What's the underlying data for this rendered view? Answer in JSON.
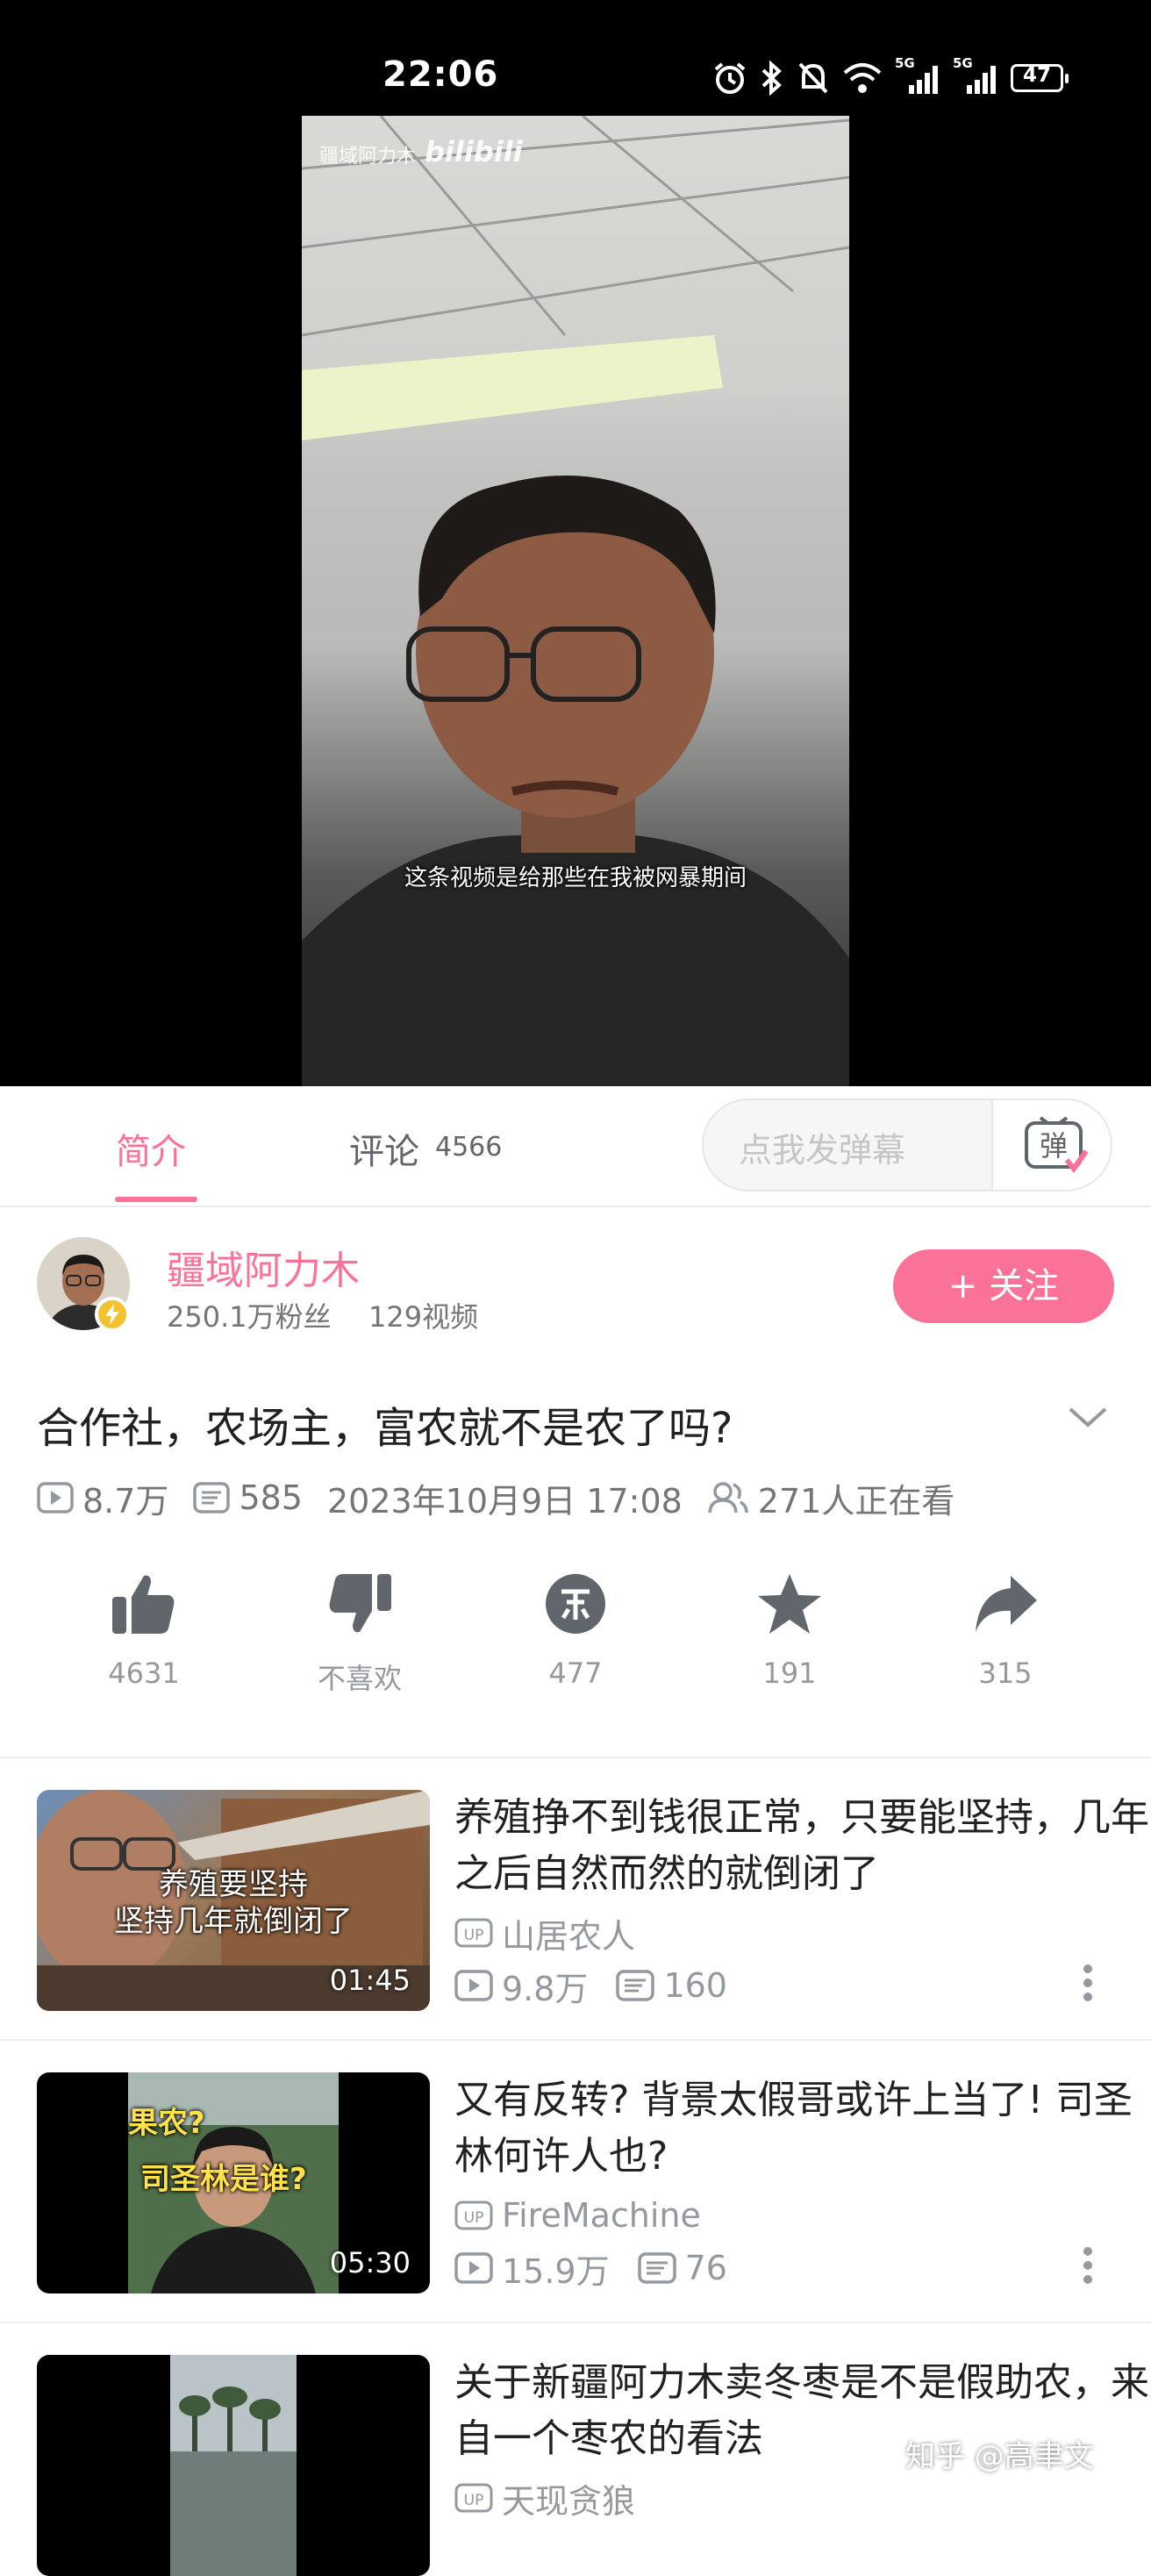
{
  "status_bar": {
    "time": "22:06",
    "battery": "47",
    "network_tags": [
      "5G",
      "5G"
    ],
    "icons": [
      "alarm-icon",
      "bluetooth-icon",
      "mute-icon",
      "wifi-icon",
      "signal-icon",
      "signal-icon",
      "battery-icon"
    ]
  },
  "video": {
    "watermark_name": "疆域阿力木",
    "watermark_logo": "bilibili",
    "subtitle": "这条视频是给那些在我被网暴期间"
  },
  "tabs": {
    "intro": "简介",
    "comments": "评论",
    "comments_count": "4566"
  },
  "danmaku": {
    "placeholder": "点我发弹幕",
    "toggle_label": "弹"
  },
  "uploader": {
    "name": "疆域阿力木",
    "fans": "250.1万粉丝",
    "videos": "129视频",
    "follow_label": "+ 关注"
  },
  "video_info": {
    "title": "合作社，农场主，富农就不是农了吗?",
    "views": "8.7万",
    "danmaku_count": "585",
    "date": "2023年10月9日 17:08",
    "watching": "271人正在看"
  },
  "actions": [
    {
      "icon": "like-icon",
      "label": "4631"
    },
    {
      "icon": "dislike-icon",
      "label": "不喜欢"
    },
    {
      "icon": "coin-icon",
      "label": "477"
    },
    {
      "icon": "favorite-icon",
      "label": "191"
    },
    {
      "icon": "share-icon",
      "label": "315"
    }
  ],
  "recommendations": [
    {
      "title": "养殖挣不到钱很正常，只要能坚持，几年之后自然而然的就倒闭了",
      "uploader": "山居农人",
      "views": "9.8万",
      "danmaku": "160",
      "duration": "01:45",
      "thumb_caption_1": "养殖要坚持",
      "thumb_caption_2": "坚持几年就倒闭了"
    },
    {
      "title": "又有反转? 背景太假哥或许上当了! 司圣林何许人也?",
      "uploader": "FireMachine",
      "views": "15.9万",
      "danmaku": "76",
      "duration": "05:30",
      "thumb_caption_1": "果农?",
      "thumb_caption_2": "司圣林是谁?"
    },
    {
      "title": "关于新疆阿力木卖冬枣是不是假助农，来自一个枣农的看法",
      "uploader": "天现贪狼",
      "views": "",
      "danmaku": "",
      "duration": "",
      "thumb_caption_1": "",
      "thumb_caption_2": ""
    }
  ],
  "up_badge": "UP",
  "overlay_watermark": "知乎 @高聿文",
  "colors": {
    "accent": "#fb7299",
    "text": "#212121",
    "muted": "#9499a0"
  }
}
